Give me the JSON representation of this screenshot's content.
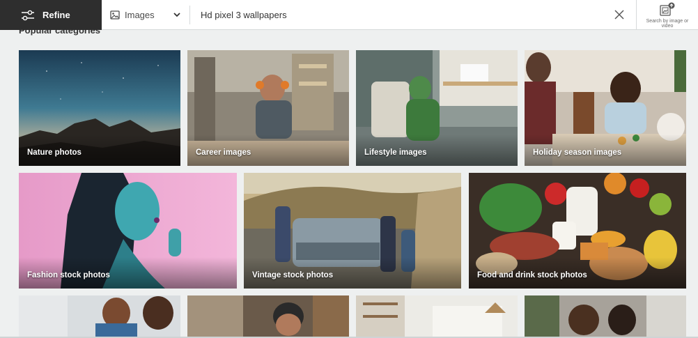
{
  "topbar": {
    "refine_label": "Refine",
    "content_type": "Images",
    "search_value": "Hd pixel 3 wallpapers",
    "visual_search_label": "Search by image or video"
  },
  "section": {
    "heading": "Popular categories"
  },
  "tiles": [
    {
      "label": "Nature photos"
    },
    {
      "label": "Career images"
    },
    {
      "label": "Lifestyle images"
    },
    {
      "label": "Holiday season images"
    },
    {
      "label": "Fashion stock photos"
    },
    {
      "label": "Vintage stock photos"
    },
    {
      "label": "Food and drink stock photos"
    }
  ],
  "colors": {
    "refine_bg": "#2e2e2e",
    "page_bg": "#eef0f0",
    "label_text": "#ffffff"
  }
}
